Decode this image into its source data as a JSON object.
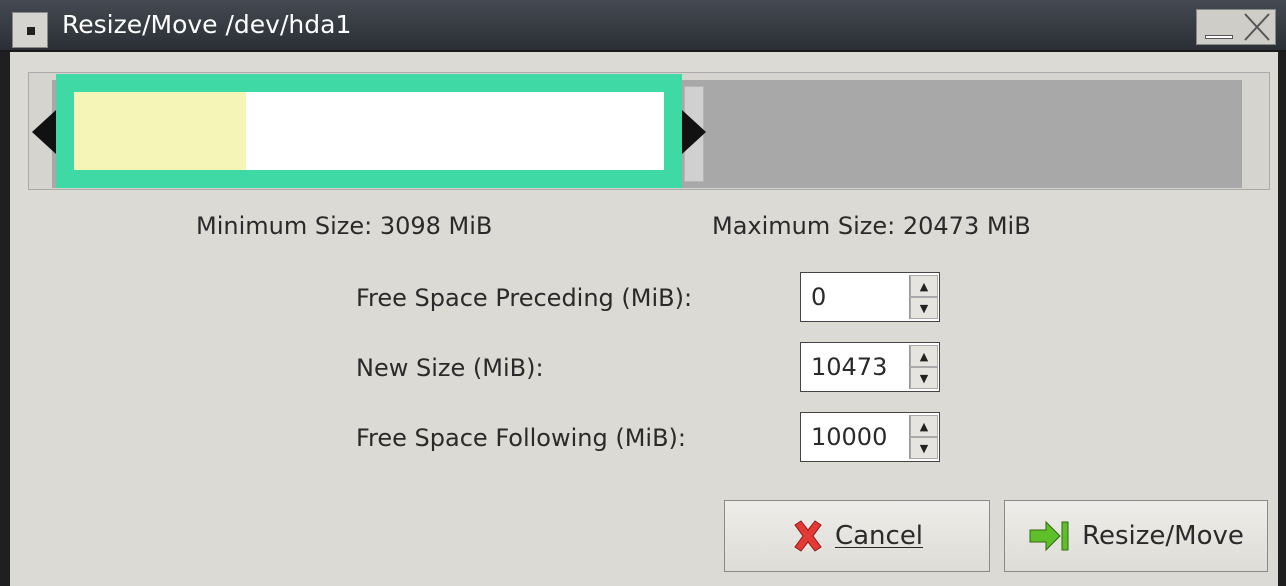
{
  "window": {
    "title": "Resize/Move /dev/hda1"
  },
  "sizes": {
    "minimum": "Minimum Size: 3098 MiB",
    "maximum": "Maximum Size: 20473 MiB"
  },
  "fields": [
    {
      "label": "Free Space Preceding (MiB):",
      "value": "0"
    },
    {
      "label": "New Size (MiB):",
      "value": "10473"
    },
    {
      "label": "Free Space Following (MiB):",
      "value": "10000"
    }
  ],
  "buttons": {
    "cancel": "Cancel",
    "resize": "Resize/Move"
  },
  "colors": {
    "partition_border": "#3fd9a6",
    "used_space": "#f6f5b8",
    "unallocated": "#a8a8a8"
  }
}
